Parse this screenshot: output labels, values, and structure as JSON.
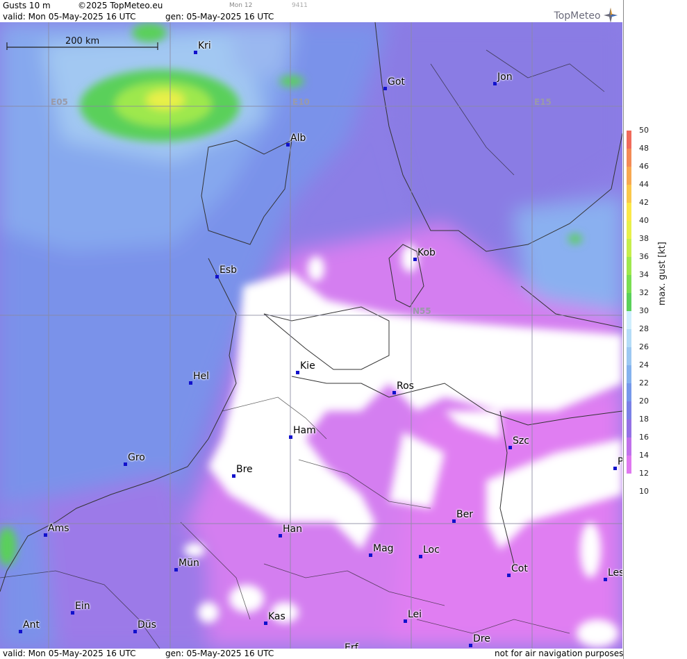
{
  "header": {
    "product": "Gusts 10 m",
    "copyright": "©2025 TopMeteo.eu",
    "run_code": "Mon 12",
    "id_code": "9411",
    "valid": "valid:  Mon  05-May-2025  16 UTC",
    "generated": "gen: 05-May-2025 16 UTC",
    "logo": "TopMeteo"
  },
  "footer": {
    "valid": "valid:  Mon  05-May-2025  16 UTC",
    "generated": "gen: 05-May-2025 16 UTC",
    "disclaimer": "not for air navigation purposes"
  },
  "map": {
    "scale_label": "200 km",
    "grid_labels": {
      "e05": "E05",
      "e10": "E10",
      "e15": "E15",
      "n55": "N55"
    },
    "cities": [
      {
        "name": "Kri"
      },
      {
        "name": "Got"
      },
      {
        "name": "Jon"
      },
      {
        "name": "Alb"
      },
      {
        "name": "Kob"
      },
      {
        "name": "Esb"
      },
      {
        "name": "Kie"
      },
      {
        "name": "Hel"
      },
      {
        "name": "Ros"
      },
      {
        "name": "Ham"
      },
      {
        "name": "Szc"
      },
      {
        "name": "Gro"
      },
      {
        "name": "Bre"
      },
      {
        "name": "P"
      },
      {
        "name": "Ber"
      },
      {
        "name": "Ams"
      },
      {
        "name": "Han"
      },
      {
        "name": "Mag"
      },
      {
        "name": "Loc"
      },
      {
        "name": "Mün"
      },
      {
        "name": "Cot"
      },
      {
        "name": "Les"
      },
      {
        "name": "Ein"
      },
      {
        "name": "Kas"
      },
      {
        "name": "Lei"
      },
      {
        "name": "Ant"
      },
      {
        "name": "Düs"
      },
      {
        "name": "Dre"
      },
      {
        "name": "Erf"
      }
    ]
  },
  "legend": {
    "title": "max. gust [kt]",
    "ticks": [
      "50",
      "48",
      "46",
      "44",
      "42",
      "40",
      "38",
      "36",
      "34",
      "32",
      "30",
      "28",
      "26",
      "24",
      "22",
      "20",
      "18",
      "16",
      "14",
      "12",
      "10"
    ],
    "colors": [
      "#f06a5a",
      "#f38a55",
      "#f7a850",
      "#fac84a",
      "#fbe848",
      "#e8f04a",
      "#c6ee4c",
      "#9ee84e",
      "#7ade52",
      "#5ad05a",
      "#cfeefd",
      "#b4dcf7",
      "#9cc8f2",
      "#84b2ee",
      "#7698ea",
      "#7a80e6",
      "#9470e4",
      "#c070ea",
      "#e078f0"
    ]
  }
}
